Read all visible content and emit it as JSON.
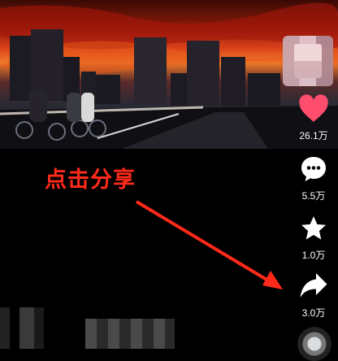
{
  "actions": {
    "like": {
      "count": "26.1万",
      "icon": "heart-icon",
      "color": "#ff4d6d"
    },
    "comment": {
      "count": "5.5万",
      "icon": "comment-icon"
    },
    "favorite": {
      "count": "1.0万",
      "icon": "star-icon"
    },
    "share": {
      "count": "3.0万",
      "icon": "share-icon"
    }
  },
  "annotation": {
    "text": "点击分享",
    "color": "#ff2a1a"
  },
  "colors": {
    "background": "#000000",
    "accent": "#ff4d6d"
  }
}
